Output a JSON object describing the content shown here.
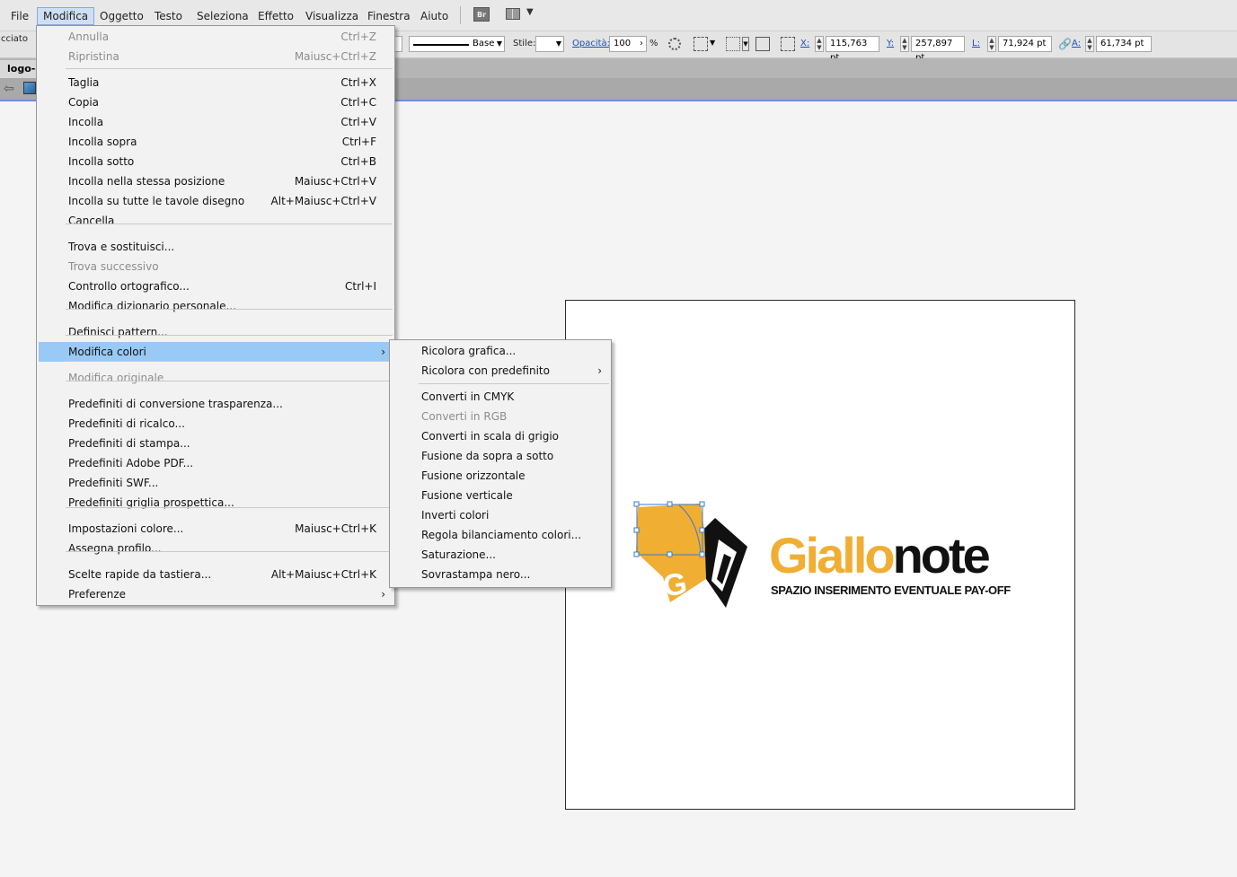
{
  "menubar": {
    "items": [
      "File",
      "Modifica",
      "Oggetto",
      "Testo",
      "Seleziona",
      "Effetto",
      "Visualizza",
      "Finestra",
      "Aiuto"
    ],
    "bridge_label": "Br"
  },
  "controlbar": {
    "left_text": "cciato",
    "stroke_label": "Base",
    "style_label": "Stile:",
    "opacity_label": "Opacità:",
    "opacity_value": "100",
    "opacity_unit": "%",
    "x_label": "X:",
    "x_value": "115,763 pt",
    "y_label": "Y:",
    "y_value": "257,897 pt",
    "w_label": "L:",
    "w_value": "71,924 pt",
    "h_label": "A:",
    "h_value": "61,734 pt"
  },
  "document": {
    "tab_label": "logo-c"
  },
  "edit_menu": {
    "items": [
      {
        "label": "Annulla",
        "shortcut": "Ctrl+Z",
        "disabled": true
      },
      {
        "label": "Ripristina",
        "shortcut": "Maiusc+Ctrl+Z",
        "disabled": true
      },
      {
        "label": "Taglia",
        "shortcut": "Ctrl+X"
      },
      {
        "label": "Copia",
        "shortcut": "Ctrl+C"
      },
      {
        "label": "Incolla",
        "shortcut": "Ctrl+V"
      },
      {
        "label": "Incolla sopra",
        "shortcut": "Ctrl+F"
      },
      {
        "label": "Incolla sotto",
        "shortcut": "Ctrl+B"
      },
      {
        "label": "Incolla nella stessa posizione",
        "shortcut": "Maiusc+Ctrl+V"
      },
      {
        "label": "Incolla su tutte le tavole disegno",
        "shortcut": "Alt+Maiusc+Ctrl+V"
      },
      {
        "label": "Cancella",
        "shortcut": ""
      },
      {
        "label": "Trova e sostituisci...",
        "shortcut": ""
      },
      {
        "label": "Trova successivo",
        "shortcut": "",
        "disabled": true
      },
      {
        "label": "Controllo ortografico...",
        "shortcut": "Ctrl+I"
      },
      {
        "label": "Modifica dizionario personale...",
        "shortcut": ""
      },
      {
        "label": "Definisci pattern...",
        "shortcut": ""
      },
      {
        "label": "Modifica colori",
        "shortcut": "",
        "submenu": true,
        "highlighted": true
      },
      {
        "label": "Modifica originale",
        "shortcut": "",
        "disabled": true
      },
      {
        "label": "Predefiniti di conversione trasparenza...",
        "shortcut": ""
      },
      {
        "label": "Predefiniti di ricalco...",
        "shortcut": ""
      },
      {
        "label": "Predefiniti di stampa...",
        "shortcut": ""
      },
      {
        "label": "Predefiniti Adobe PDF...",
        "shortcut": ""
      },
      {
        "label": "Predefiniti SWF...",
        "shortcut": ""
      },
      {
        "label": "Predefiniti griglia prospettica...",
        "shortcut": ""
      },
      {
        "label": "Impostazioni colore...",
        "shortcut": "Maiusc+Ctrl+K"
      },
      {
        "label": "Assegna profilo...",
        "shortcut": ""
      },
      {
        "label": "Scelte rapide da tastiera...",
        "shortcut": "Alt+Maiusc+Ctrl+K"
      },
      {
        "label": "Preferenze",
        "shortcut": "",
        "submenu": true
      }
    ]
  },
  "colors_submenu": {
    "items": [
      {
        "label": "Ricolora grafica..."
      },
      {
        "label": "Ricolora con predefinito",
        "submenu": true
      },
      {
        "label": "Converti in CMYK"
      },
      {
        "label": "Converti in RGB",
        "disabled": true
      },
      {
        "label": "Converti in scala di grigio"
      },
      {
        "label": "Fusione da sopra a sotto"
      },
      {
        "label": "Fusione orizzontale"
      },
      {
        "label": "Fusione verticale"
      },
      {
        "label": "Inverti colori"
      },
      {
        "label": "Regola bilanciamento colori..."
      },
      {
        "label": "Saturazione..."
      },
      {
        "label": "Sovrastampa nero..."
      }
    ]
  },
  "logo": {
    "word_part1": "Giallo",
    "word_part2": "note",
    "tagline": "SPAZIO INSERIMENTO EVENTUALE PAY-OFF",
    "colors": {
      "yellow": "#f0ae33",
      "black": "#111111"
    }
  }
}
